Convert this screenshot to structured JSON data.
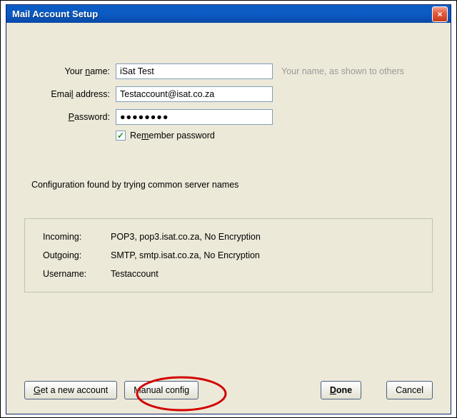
{
  "window": {
    "title": "Mail Account Setup",
    "close_symbol": "×"
  },
  "form": {
    "name_label_pre": "Your ",
    "name_label_u": "n",
    "name_label_post": "ame:",
    "name_value": "iSat Test",
    "name_hint": "Your name, as shown to others",
    "email_label_pre": "Emai",
    "email_label_u": "l",
    "email_label_post": " address:",
    "email_value": "Testaccount@isat.co.za",
    "password_label_u": "P",
    "password_label_post": "assword:",
    "password_dots": "●●●●●●●●",
    "remember_checkmark": "✓",
    "remember_pre": "Re",
    "remember_u": "m",
    "remember_post": "ember password"
  },
  "status_message": "Configuration found by trying common server names",
  "server": {
    "incoming_label": "Incoming:",
    "incoming_value": "POP3, pop3.isat.co.za, No Encryption",
    "outgoing_label": "Outgoing:",
    "outgoing_value": "SMTP, smtp.isat.co.za, No Encryption",
    "username_label": "Username:",
    "username_value": "Testaccount"
  },
  "buttons": {
    "get_account_u": "G",
    "get_account_post": "et a new account",
    "manual_pre": "Manual confi",
    "manual_u": "g",
    "done_u": "D",
    "done_post": "one",
    "cancel": "Cancel"
  },
  "chart_data": null
}
